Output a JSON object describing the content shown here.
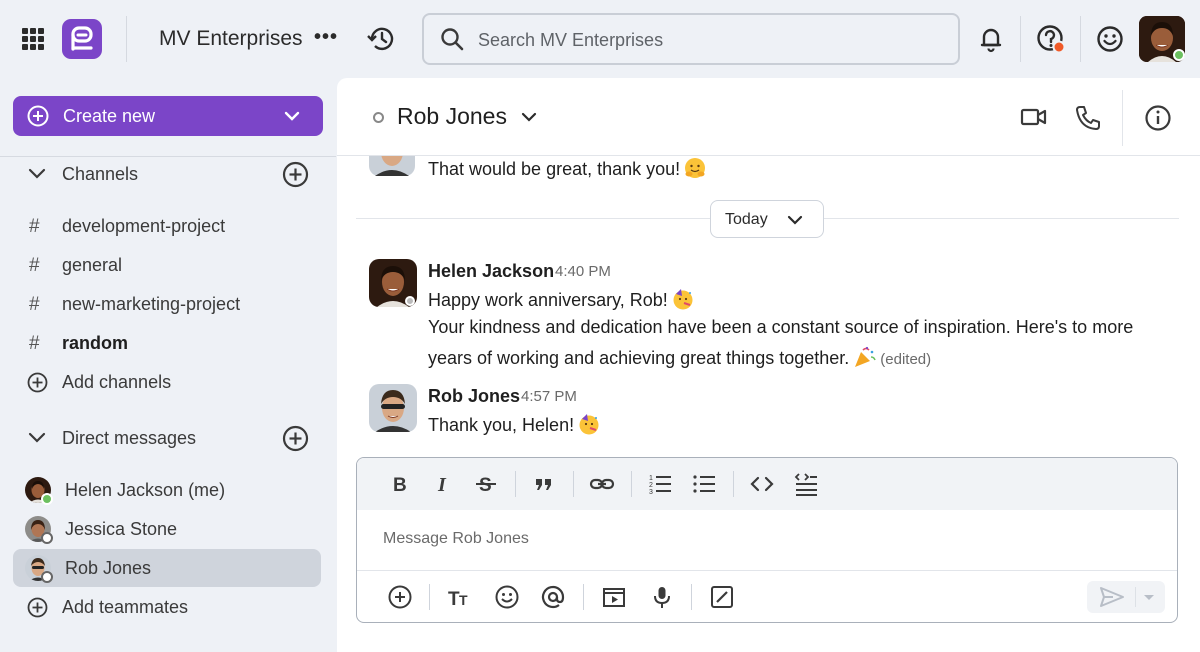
{
  "topbar": {
    "org_name": "MV Enterprises",
    "org_more": "•••",
    "search_placeholder": "Search MV Enterprises"
  },
  "sidebar": {
    "create_label": "Create new",
    "channels_label": "Channels",
    "channels": [
      {
        "label": "development-project",
        "unread": false
      },
      {
        "label": "general",
        "unread": false
      },
      {
        "label": "new-marketing-project",
        "unread": false
      },
      {
        "label": "random",
        "unread": true
      }
    ],
    "add_channels_label": "Add channels",
    "dm_label": "Direct messages",
    "dms": [
      {
        "label": "Helen Jackson (me)",
        "status": "online"
      },
      {
        "label": "Jessica Stone",
        "status": "offline"
      },
      {
        "label": "Rob Jones",
        "status": "offline",
        "active": true
      }
    ],
    "add_teammates_label": "Add teammates"
  },
  "chat": {
    "title": "Rob Jones",
    "prev_message": "That would be great, thank you!",
    "divider_label": "Today",
    "messages": [
      {
        "author": "Helen Jackson",
        "time": "4:40 PM",
        "lines": [
          "Happy work anniversary, Rob!",
          "Your kindness and dedication have been a constant source of inspiration. Here's to more",
          "years of working and achieving great things together."
        ],
        "edited_label": "(edited)"
      },
      {
        "author": "Rob Jones",
        "time": "4:57 PM",
        "lines": [
          "Thank you, Helen!"
        ]
      }
    ],
    "composer_placeholder": "Message Rob Jones"
  },
  "colors": {
    "brand": "#7b45c8",
    "online": "#6cc05f",
    "notification": "#f05a28"
  }
}
